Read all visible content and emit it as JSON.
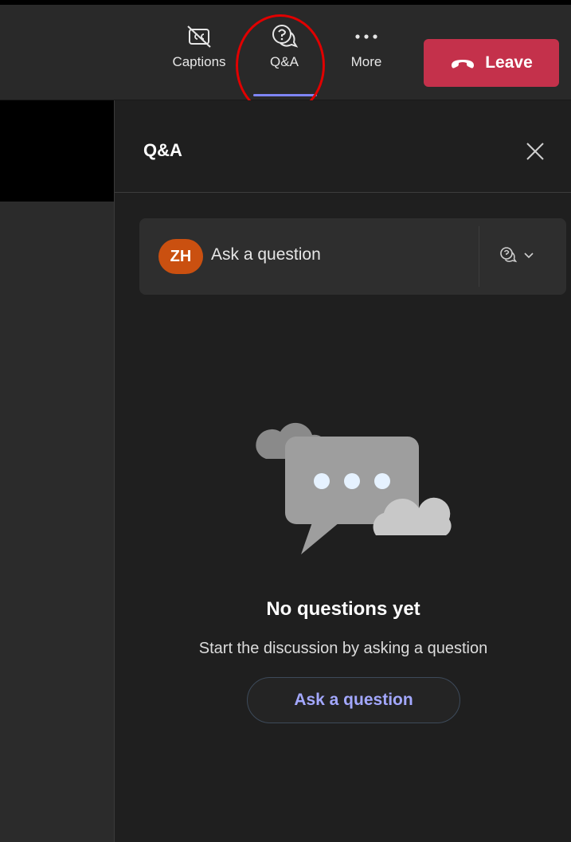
{
  "toolbar": {
    "captions_label": "Captions",
    "qa_label": "Q&A",
    "more_label": "More",
    "leave_label": "Leave"
  },
  "panel": {
    "title": "Q&A",
    "avatar_initials": "ZH",
    "ask_placeholder": "Ask a question",
    "empty_title": "No questions yet",
    "empty_subtitle": "Start the discussion by asking a question",
    "ask_button_label": "Ask a question"
  },
  "colors": {
    "accent": "#7f85f5",
    "leave": "#c4314b",
    "avatar": "#ca5010",
    "highlight": "#e00000"
  }
}
